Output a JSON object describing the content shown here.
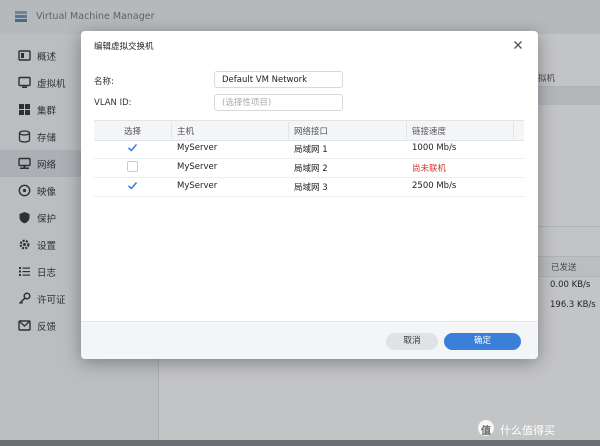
{
  "app": {
    "title": "Virtual Machine Manager"
  },
  "sidebar": {
    "items": [
      {
        "label": "概述",
        "icon": "overview-icon"
      },
      {
        "label": "虚拟机",
        "icon": "vm-icon"
      },
      {
        "label": "集群",
        "icon": "cluster-icon"
      },
      {
        "label": "存储",
        "icon": "storage-icon"
      },
      {
        "label": "网络",
        "icon": "network-icon",
        "active": true
      },
      {
        "label": "映像",
        "icon": "image-icon"
      },
      {
        "label": "保护",
        "icon": "shield-icon"
      },
      {
        "label": "设置",
        "icon": "gear-icon"
      },
      {
        "label": "日志",
        "icon": "log-icon"
      },
      {
        "label": "许可证",
        "icon": "key-icon"
      },
      {
        "label": "反馈",
        "icon": "feedback-icon"
      }
    ]
  },
  "background": {
    "col_vm_partial": "拟机",
    "col_sent": "已发送",
    "rows": [
      "0.00 KB/s",
      "196.3 KB/s"
    ]
  },
  "dialog": {
    "title": "编辑虚拟交换机",
    "name_label": "名称:",
    "name_value": "Default VM Network",
    "vlan_label": "VLAN ID:",
    "vlan_placeholder": "(选择性项目)",
    "columns": [
      "选择",
      "主机",
      "网络接口",
      "链接速度"
    ],
    "rows": [
      {
        "checked": true,
        "host": "MyServer",
        "iface": "局域网 1",
        "speed": "1000 Mb/s",
        "offline": false
      },
      {
        "checked": false,
        "host": "MyServer",
        "iface": "局域网 2",
        "speed": "尚未联机",
        "offline": true
      },
      {
        "checked": true,
        "host": "MyServer",
        "iface": "局域网 3",
        "speed": "2500 Mb/s",
        "offline": false
      }
    ],
    "cancel_label": "取消",
    "ok_label": "确定"
  },
  "colors": {
    "accent": "#3a7fd8",
    "offline": "#d9342b"
  },
  "watermark": {
    "badge": "值",
    "text": "什么值得买"
  }
}
